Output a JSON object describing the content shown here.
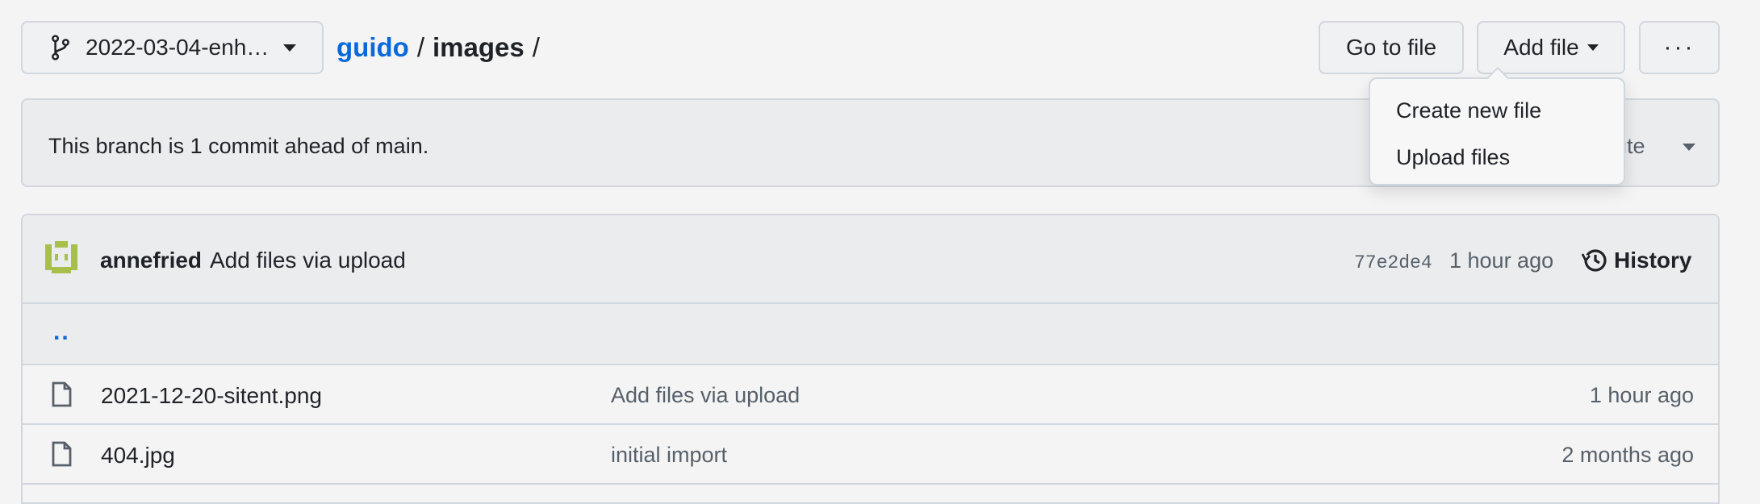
{
  "branch_selector": {
    "label": "2022-03-04-enh…",
    "icon": "git-branch-icon"
  },
  "breadcrumb": {
    "root": "guido",
    "separator": "/",
    "current": "images",
    "trailing": "/"
  },
  "toolbar": {
    "go_to_file": "Go to file",
    "add_file": "Add file",
    "more": "···"
  },
  "add_file_menu": {
    "items": [
      "Create new file",
      "Upload files"
    ]
  },
  "branch_banner": {
    "message": "This branch is 1 commit ahead of main.",
    "contribute_partial": "ute"
  },
  "latest_commit": {
    "author": "annefried",
    "message": "Add files via upload",
    "sha": "77e2de4",
    "time": "1 hour ago",
    "history_label": "History"
  },
  "file_list": {
    "parent": "..",
    "rows": [
      {
        "name": "2021-12-20-sitent.png",
        "message": "Add files via upload",
        "time": "1 hour ago",
        "icon": "file-icon"
      },
      {
        "name": "404.jpg",
        "message": "initial import",
        "time": "2 months ago",
        "icon": "file-icon"
      }
    ]
  },
  "colors": {
    "link": "#0969da",
    "border": "#d0d7de",
    "muted": "#57606a",
    "avatar": "#a6c04a"
  }
}
